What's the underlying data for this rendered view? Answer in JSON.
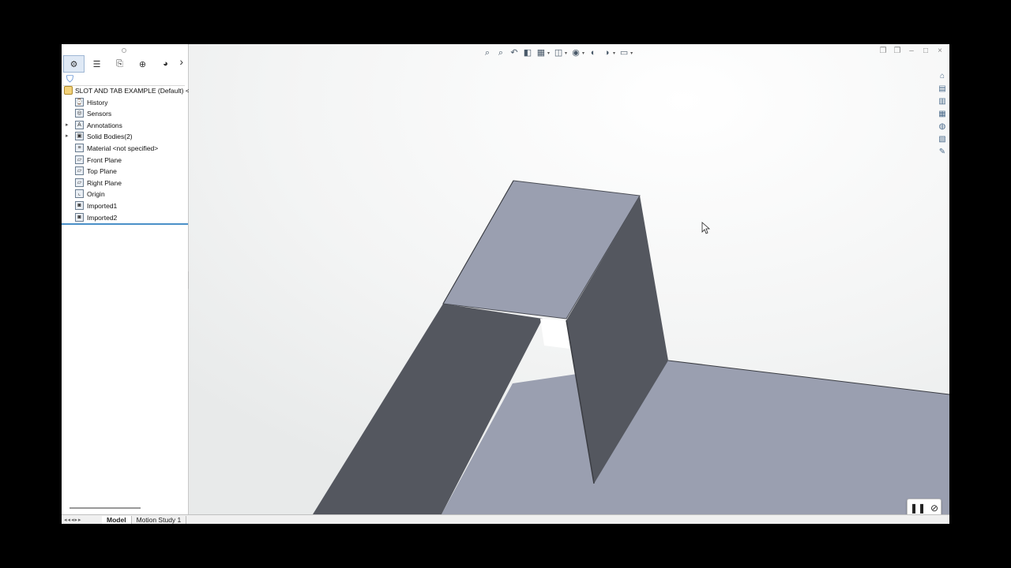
{
  "tree": {
    "root": "SLOT AND TAB EXAMPLE (Default) <<De",
    "items": [
      {
        "label": "History",
        "icon": "history-icon",
        "glyph": "⌚",
        "expandable": false
      },
      {
        "label": "Sensors",
        "icon": "sensor-icon",
        "glyph": "◎",
        "expandable": false
      },
      {
        "label": "Annotations",
        "icon": "annotation-icon",
        "glyph": "A",
        "expandable": true
      },
      {
        "label": "Solid Bodies(2)",
        "icon": "solid-bodies-icon",
        "glyph": "▣",
        "expandable": true
      },
      {
        "label": "Material <not specified>",
        "icon": "material-icon",
        "glyph": "≡",
        "expandable": false
      },
      {
        "label": "Front Plane",
        "icon": "plane-icon",
        "glyph": "▱",
        "expandable": false
      },
      {
        "label": "Top Plane",
        "icon": "plane-icon",
        "glyph": "▱",
        "expandable": false
      },
      {
        "label": "Right Plane",
        "icon": "plane-icon",
        "glyph": "▱",
        "expandable": false
      },
      {
        "label": "Origin",
        "icon": "origin-icon",
        "glyph": "⌞",
        "expandable": false
      },
      {
        "label": "Imported1",
        "icon": "imported-body-icon",
        "glyph": "◙",
        "expandable": false
      },
      {
        "label": "Imported2",
        "icon": "imported-body-icon",
        "glyph": "◙",
        "expandable": false
      }
    ]
  },
  "bottom_tabs": [
    "Model",
    "Motion Study 1"
  ],
  "colors": {
    "face_top": "#9a9fb0",
    "face_side": "#54575f",
    "background_light": "#f7f8f8"
  }
}
